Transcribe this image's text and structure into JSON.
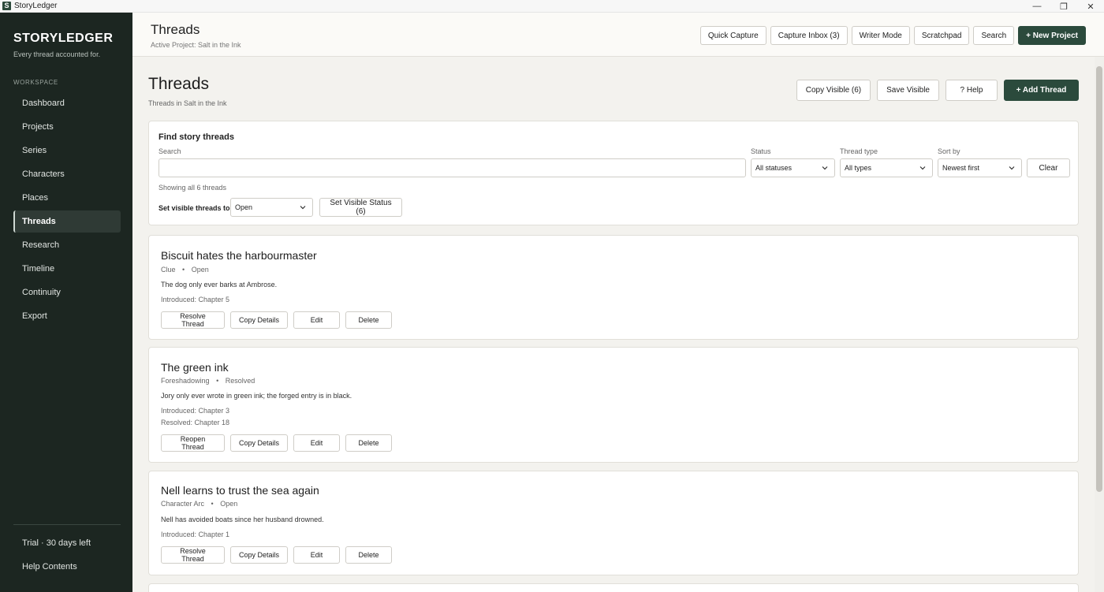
{
  "window": {
    "title": "StoryLedger"
  },
  "sidebar": {
    "brand": "STORYLEDGER",
    "tagline": "Every thread accounted for.",
    "section": "WORKSPACE",
    "items": [
      {
        "label": "Dashboard"
      },
      {
        "label": "Projects"
      },
      {
        "label": "Series"
      },
      {
        "label": "Characters"
      },
      {
        "label": "Places"
      },
      {
        "label": "Threads",
        "active": true
      },
      {
        "label": "Research"
      },
      {
        "label": "Timeline"
      },
      {
        "label": "Continuity"
      },
      {
        "label": "Export"
      }
    ],
    "trial": "Trial · 30 days left",
    "help": "Help Contents"
  },
  "header": {
    "title": "Threads",
    "subtitle": "Active Project: Salt in the Ink",
    "actions": {
      "quick_capture": "Quick Capture",
      "capture_inbox": "Capture Inbox (3)",
      "writer_mode": "Writer Mode",
      "scratchpad": "Scratchpad",
      "search": "Search",
      "new_project": "+ New Project"
    }
  },
  "page": {
    "title": "Threads",
    "subtitle": "Threads in Salt in the Ink",
    "actions": {
      "copy_visible": "Copy Visible (6)",
      "save_visible": "Save Visible",
      "help": "? Help",
      "add_thread": "+ Add Thread"
    }
  },
  "filters": {
    "title": "Find story threads",
    "search_label": "Search",
    "search_value": "",
    "status_label": "Status",
    "status_value": "All statuses",
    "type_label": "Thread type",
    "type_value": "All types",
    "sort_label": "Sort by",
    "sort_value": "Newest first",
    "clear": "Clear",
    "showing": "Showing all 6 threads",
    "set_visible_label": "Set visible threads to",
    "set_visible_value": "Open",
    "set_visible_button": "Set Visible Status (6)"
  },
  "threads": [
    {
      "title": "Biscuit hates the harbourmaster",
      "type": "Clue",
      "status": "Open",
      "description": "The dog only ever barks at Ambrose.",
      "introduced": "Introduced: Chapter 5",
      "resolved": "",
      "primary_action": "Resolve Thread"
    },
    {
      "title": "The green ink",
      "type": "Foreshadowing",
      "status": "Resolved",
      "description": "Jory only ever wrote in green ink; the forged entry is in black.",
      "introduced": "Introduced: Chapter 3",
      "resolved": "Resolved: Chapter 18",
      "primary_action": "Reopen Thread"
    },
    {
      "title": "Nell learns to trust the sea again",
      "type": "Character Arc",
      "status": "Open",
      "description": "Nell has avoided boats since her husband drowned.",
      "introduced": "Introduced: Chapter 1",
      "resolved": "",
      "primary_action": "Resolve Thread"
    }
  ],
  "thread_actions": {
    "copy": "Copy Details",
    "edit": "Edit",
    "delete": "Delete"
  },
  "colors": {
    "sidebar_bg": "#1c2621",
    "primary": "#2b4a3c",
    "page_bg": "#f3f2ee"
  }
}
